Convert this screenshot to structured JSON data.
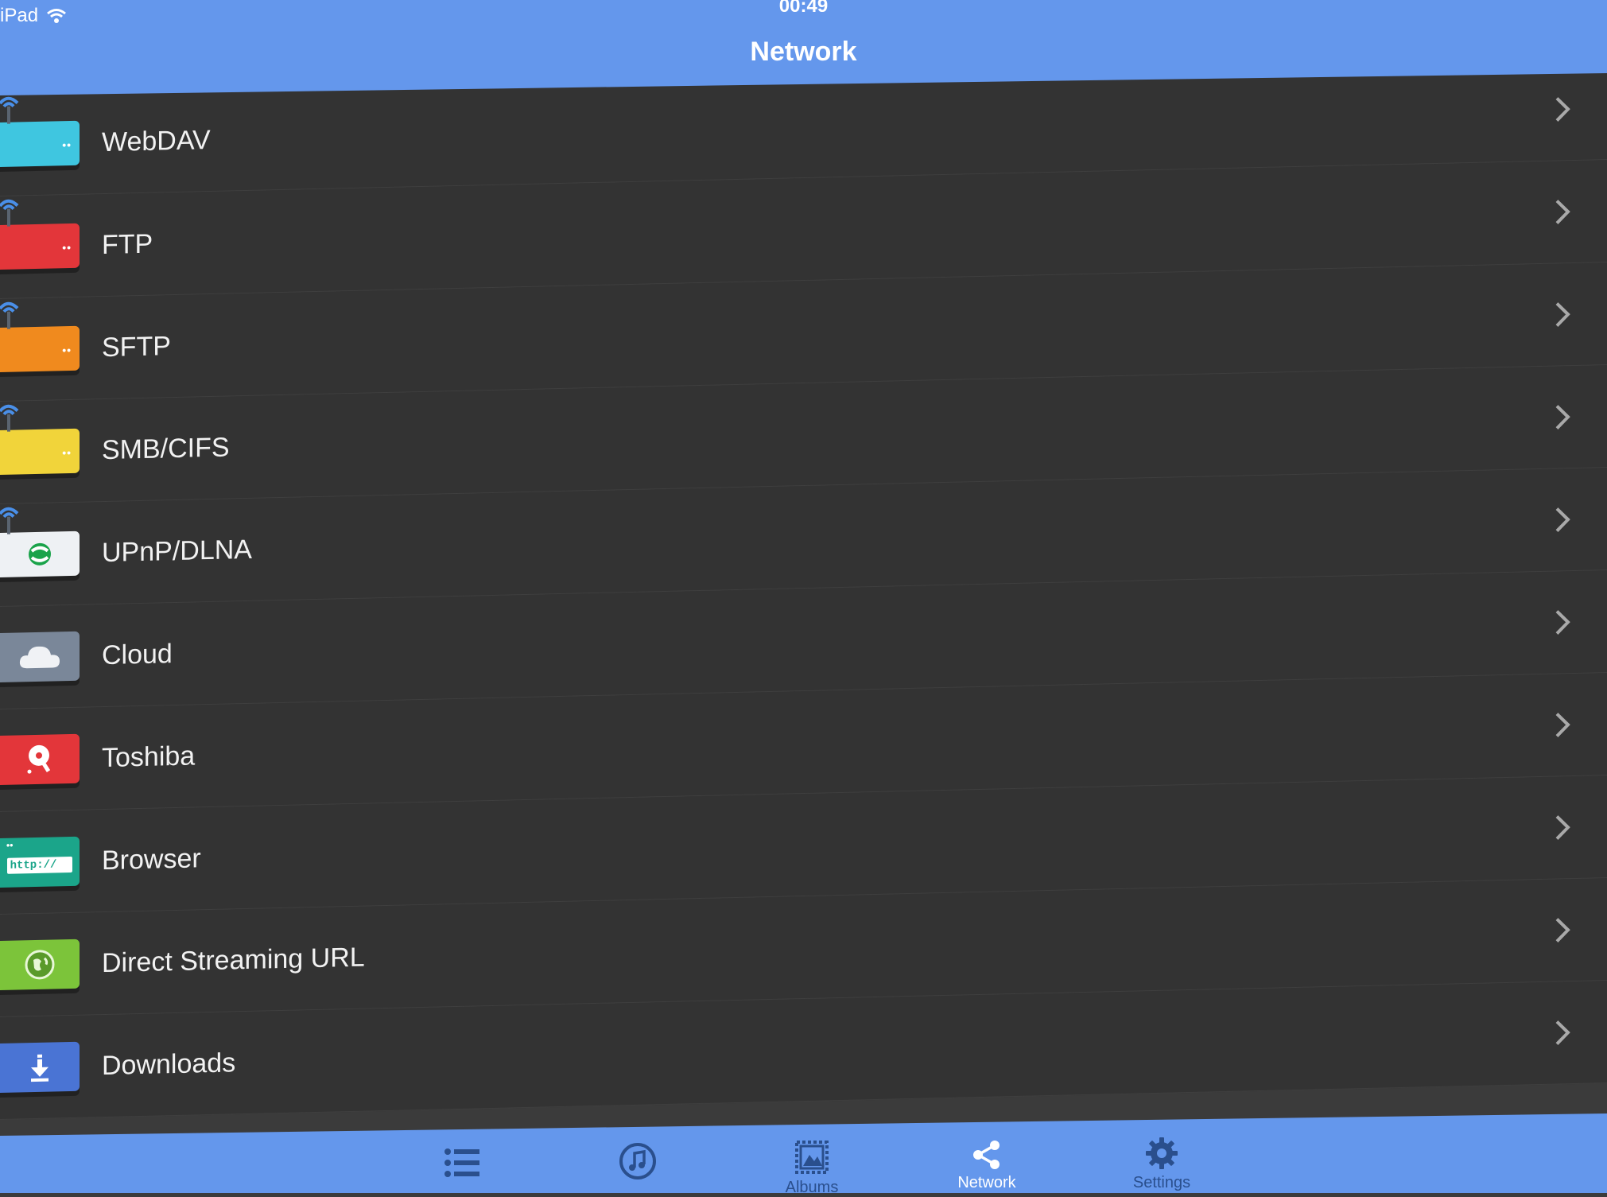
{
  "status_bar": {
    "carrier": "iPad",
    "time": "00:49"
  },
  "header": {
    "title": "Network"
  },
  "items": [
    {
      "label": "WebDAV",
      "icon": "router-icon",
      "color": "#3fc6e0"
    },
    {
      "label": "FTP",
      "icon": "router-icon",
      "color": "#e3363a"
    },
    {
      "label": "SFTP",
      "icon": "router-icon",
      "color": "#f08a1e"
    },
    {
      "label": "SMB/CIFS",
      "icon": "router-icon",
      "color": "#f1d43a"
    },
    {
      "label": "UPnP/DLNA",
      "icon": "dlna-icon",
      "color": "#eef1f4"
    },
    {
      "label": "Cloud",
      "icon": "cloud-icon",
      "color": "#7a8799"
    },
    {
      "label": "Toshiba",
      "icon": "toshiba-icon",
      "color": "#e3363a"
    },
    {
      "label": "Browser",
      "icon": "browser-icon",
      "color": "#1ba58a",
      "icon_text": "http://"
    },
    {
      "label": "Direct Streaming URL",
      "icon": "globe-icon",
      "color": "#7cc43a"
    },
    {
      "label": "Downloads",
      "icon": "download-icon",
      "color": "#4a74d4"
    }
  ],
  "tab_bar": {
    "tabs": [
      {
        "label": "",
        "icon": "list-icon"
      },
      {
        "label": "",
        "icon": "music-icon"
      },
      {
        "label": "Albums",
        "icon": "photo-icon"
      },
      {
        "label": "Network",
        "icon": "share-icon",
        "active": true
      },
      {
        "label": "Settings",
        "icon": "gear-icon"
      }
    ]
  },
  "colors": {
    "accent": "#6497ec",
    "list_background": "#333333",
    "text": "#f2f2f2"
  }
}
